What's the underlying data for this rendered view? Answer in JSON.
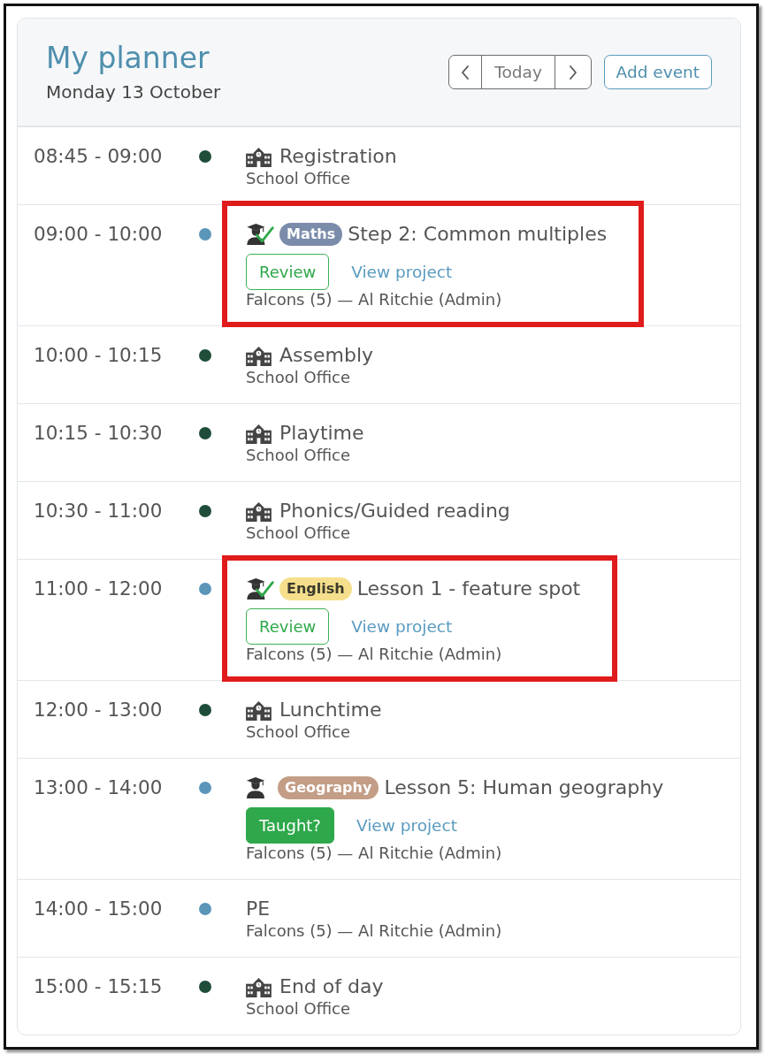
{
  "header": {
    "title": "My planner",
    "date": "Monday 13 October",
    "today": "Today",
    "add_event": "Add event"
  },
  "events": [
    {
      "time": "08:45 - 09:00",
      "color": "#1f4d3a",
      "kind": "school-event",
      "title": "Registration",
      "location": "School Office",
      "highlighted": false
    },
    {
      "time": "09:00 - 10:00",
      "color": "#5b96b9",
      "kind": "lesson",
      "subject": {
        "label": "Maths",
        "color": "#7b8cab"
      },
      "title": "Step 2: Common multiples",
      "taught": true,
      "action": "Review",
      "link": "View project",
      "details": "Falcons (5) — Al Ritchie (Admin)",
      "highlighted": true
    },
    {
      "time": "10:00 - 10:15",
      "color": "#1f4d3a",
      "kind": "school-event",
      "title": "Assembly",
      "location": "School Office",
      "highlighted": false
    },
    {
      "time": "10:15 - 10:30",
      "color": "#1f4d3a",
      "kind": "school-event",
      "title": "Playtime",
      "location": "School Office",
      "highlighted": false
    },
    {
      "time": "10:30 - 11:00",
      "color": "#1f4d3a",
      "kind": "school-event",
      "title": "Phonics/Guided reading",
      "location": "School Office",
      "highlighted": false
    },
    {
      "time": "11:00 - 12:00",
      "color": "#5b96b9",
      "kind": "lesson",
      "subject": {
        "label": "English",
        "color": "#f6df8c"
      },
      "title": "Lesson 1 - feature spot",
      "taught": true,
      "action": "Review",
      "link": "View project",
      "details": "Falcons (5) — Al Ritchie (Admin)",
      "highlighted": true
    },
    {
      "time": "12:00 - 13:00",
      "color": "#1f4d3a",
      "kind": "school-event",
      "title": "Lunchtime",
      "location": "School Office",
      "highlighted": false
    },
    {
      "time": "13:00 - 14:00",
      "color": "#5b96b9",
      "kind": "lesson",
      "subject": {
        "label": "Geography",
        "color": "#c39d86"
      },
      "title": "Lesson 5: Human geography",
      "taught": false,
      "action": "Taught?",
      "link": "View project",
      "details": "Falcons (5) — Al Ritchie (Admin)",
      "highlighted": false
    },
    {
      "time": "14:00 - 15:00",
      "color": "#5b96b9",
      "kind": "class-event",
      "title": "PE",
      "details": "Falcons (5) — Al Ritchie (Admin)",
      "highlighted": false
    },
    {
      "time": "15:00 - 15:15",
      "color": "#1f4d3a",
      "kind": "school-event",
      "title": "End of day",
      "location": "School Office",
      "highlighted": false
    }
  ]
}
